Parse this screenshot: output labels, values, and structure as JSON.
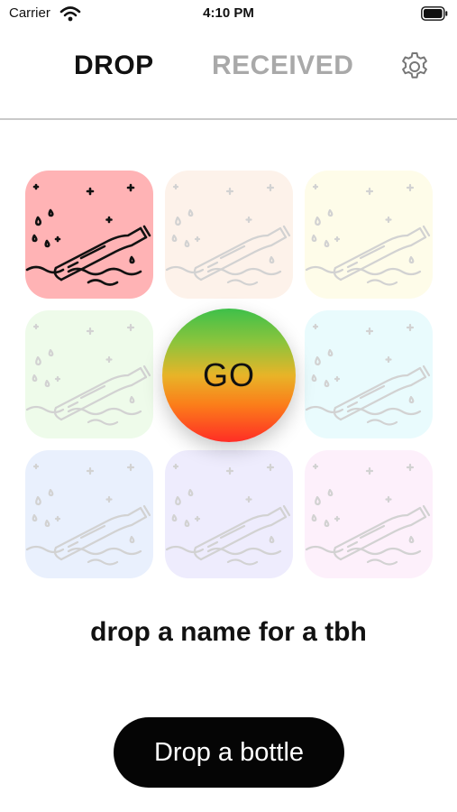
{
  "status_bar": {
    "carrier": "Carrier",
    "time": "4:10 PM"
  },
  "header": {
    "tabs": [
      {
        "label": "DROP",
        "active": true
      },
      {
        "label": "RECEIVED",
        "active": false
      }
    ],
    "settings_icon": "gear-icon"
  },
  "tiles": [
    {
      "color": "#ffb3b5",
      "selected": true
    },
    {
      "color": "#fdf2ea",
      "selected": false
    },
    {
      "color": "#fefce9",
      "selected": false
    },
    {
      "color": "#eefbea",
      "selected": false
    },
    {
      "color": "#ffffff",
      "selected": false
    },
    {
      "color": "#e9fbfd",
      "selected": false
    },
    {
      "color": "#e9f0fd",
      "selected": false
    },
    {
      "color": "#eeecfd",
      "selected": false
    },
    {
      "color": "#fdf0fb",
      "selected": false
    }
  ],
  "tile_icon": "message-in-bottle-icon",
  "go_button": {
    "label": "GO"
  },
  "prompt": "drop a name for a tbh",
  "drop_button": {
    "label": "Drop a bottle"
  }
}
